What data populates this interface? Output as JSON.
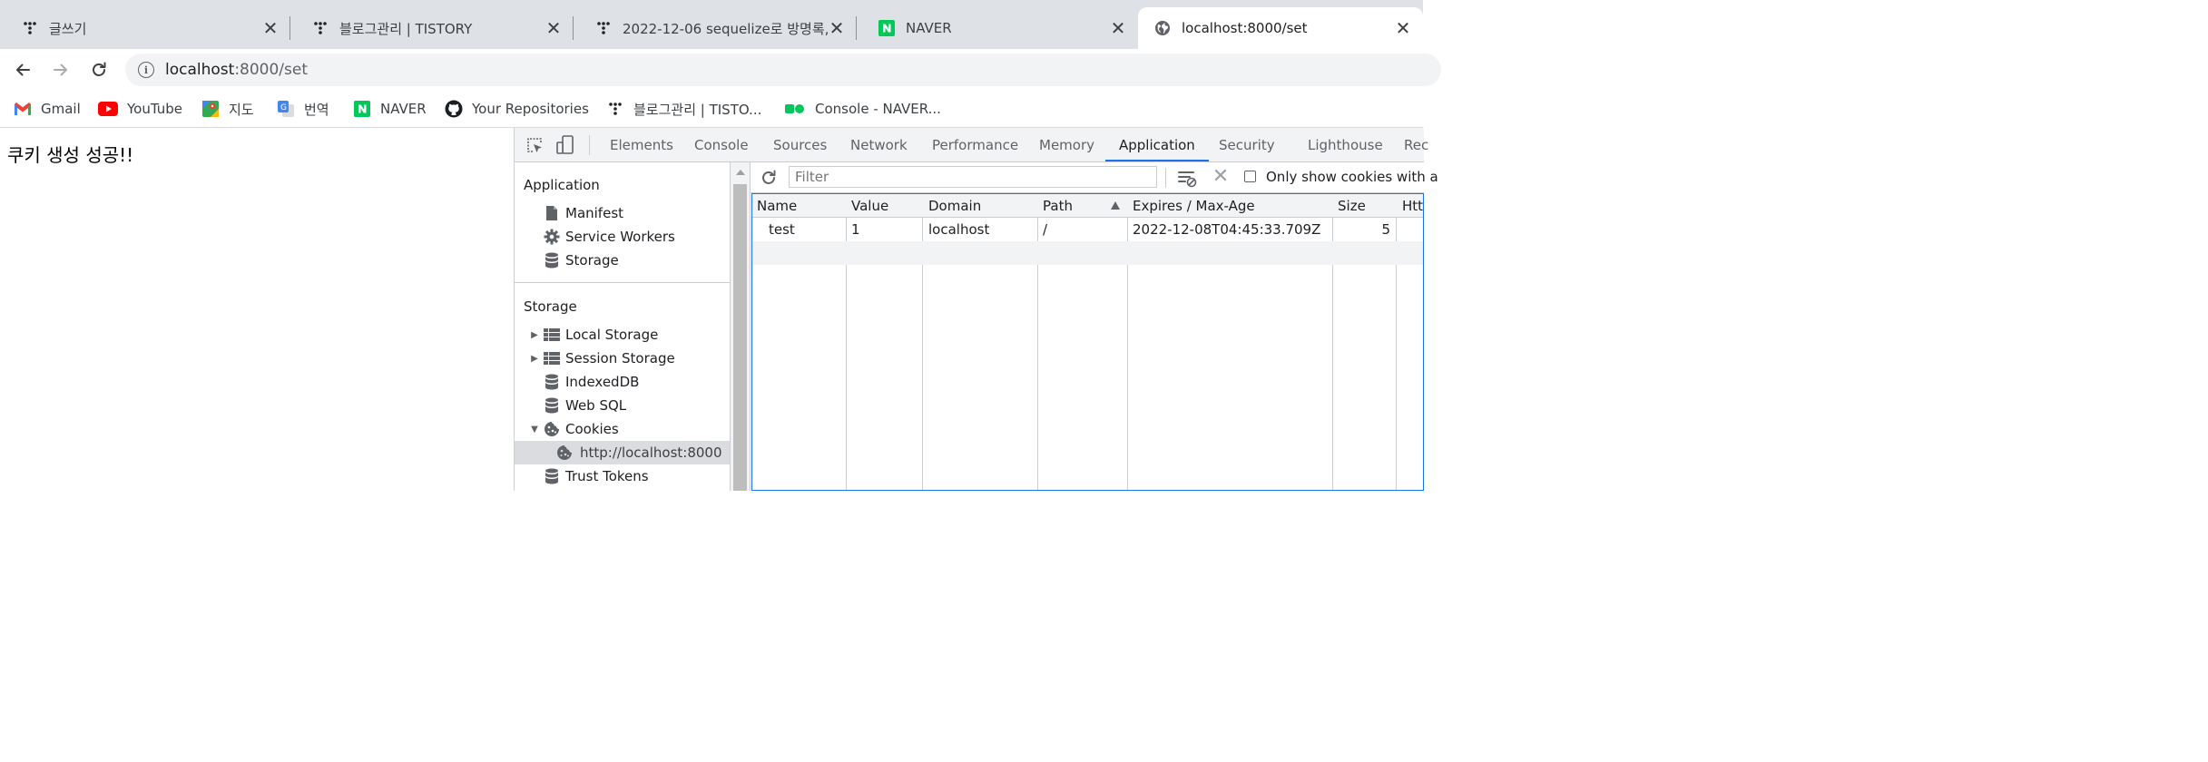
{
  "tabs": [
    {
      "title": "글쓰기",
      "favicon": "tistory-icon"
    },
    {
      "title": "블로그관리 | TISTORY",
      "favicon": "tistory-icon"
    },
    {
      "title": "2022-12-06 sequelize로 방명록,",
      "favicon": "tistory-icon"
    },
    {
      "title": "NAVER",
      "favicon": "naver-icon"
    },
    {
      "title": "localhost:8000/set",
      "favicon": "globe-icon",
      "active": true
    }
  ],
  "tab_close_glyph": "✕",
  "address": {
    "host": "localhost",
    "rest": ":8000/set"
  },
  "bookmarks": [
    {
      "label": "Gmail",
      "icon": "gmail-icon"
    },
    {
      "label": "YouTube",
      "icon": "youtube-icon"
    },
    {
      "label": "지도",
      "icon": "maps-icon"
    },
    {
      "label": "번역",
      "icon": "translate-icon"
    },
    {
      "label": "NAVER",
      "icon": "naver-icon"
    },
    {
      "label": "Your Repositories",
      "icon": "github-icon"
    },
    {
      "label": "블로그관리 | TISTO...",
      "icon": "tistory-icon"
    },
    {
      "label": "Console - NAVER...",
      "icon": "naver-cloud-icon"
    }
  ],
  "page": {
    "message": "쿠키 생성 성공!!"
  },
  "devtools": {
    "tabs": [
      "Elements",
      "Console",
      "Sources",
      "Network",
      "Performance",
      "Memory",
      "Application",
      "Security",
      "Lighthouse",
      "Rec"
    ],
    "active_tab": "Application",
    "sidebar": {
      "application_header": "Application",
      "application_items": [
        "Manifest",
        "Service Workers",
        "Storage"
      ],
      "storage_header": "Storage",
      "storage_items": [
        "Local Storage",
        "Session Storage",
        "IndexedDB",
        "Web SQL",
        "Cookies"
      ],
      "cookies_child": "http://localhost:8000",
      "trust_tokens": "Trust Tokens"
    },
    "cookies": {
      "filter_placeholder": "Filter",
      "only_show_label": "Only show cookies with a",
      "columns": [
        "Name",
        "Value",
        "Domain",
        "Path",
        "Expires / Max-Age",
        "Size",
        "Htt"
      ],
      "rows": [
        {
          "name": "test",
          "value": "1",
          "domain": "localhost",
          "path": "/",
          "expires": "2022-12-08T04:45:33.709Z",
          "size": "5"
        }
      ]
    }
  },
  "colors": {
    "accent": "#1a73e8",
    "tabstrip": "#dee1e6",
    "omnibox": "#f1f3f4"
  }
}
